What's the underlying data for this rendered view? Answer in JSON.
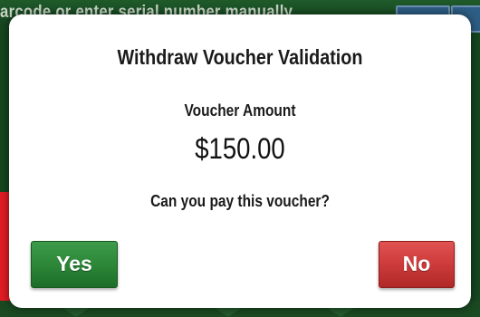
{
  "background": {
    "hint_text": "arcode or enter serial number manually"
  },
  "dialog": {
    "title": "Withdraw Voucher Validation",
    "amount_label": "Voucher Amount",
    "amount_value": "$150.00",
    "question": "Can you pay this voucher?",
    "yes_label": "Yes",
    "no_label": "No"
  },
  "colors": {
    "yes_button": "#2e8a3a",
    "no_button": "#cf3d3d",
    "accent_red": "#e21c24",
    "backdrop": "#17461f"
  }
}
